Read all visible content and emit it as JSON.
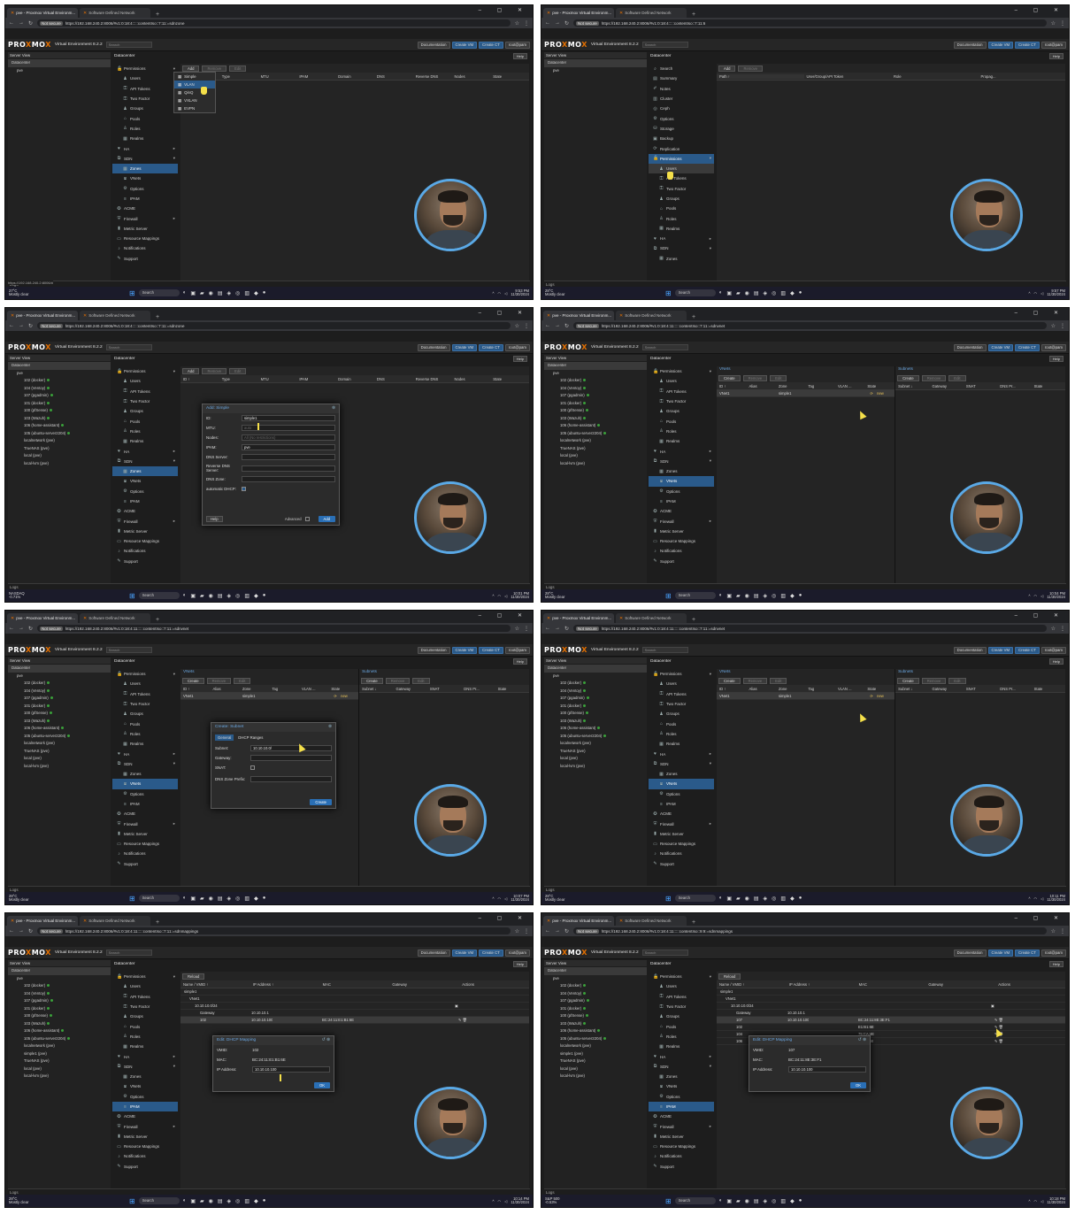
{
  "browser": {
    "tab_pve": "pve - Proxmox Virtual Environm...",
    "tab_sdn": "Software Defined Network",
    "not_secure": "Not secure",
    "urls": [
      "https://192.168.240.2:8006/#v1:0:18:4:::::contentIso::7:11:=sdnzone",
      "https://192.168.240.2:8006/#v1:0:18:4:::::contentIso::7:11:6",
      "https://192.168.240.2:8006/#v1:0:18:4:::::contentIso::7:11:=sdnzone",
      "https://192.168.240.2:8006/#v1:0:18:4:11:::::contentIso::7:11:=sdnvnet",
      "https://192.168.240.2:8006/#v1:0:18:4:11:::::contentIso::7:11:=sdnvnet",
      "https://192.168.240.2:8006/#v1:0:18:4:11:::::contentIso::7:11:=sdnvnet",
      "https://192.168.240.2:8006/#v1:0:18:4:11:::::contentIso::7:11:=sdnmappings",
      "https://192.168.240.2:8006/#v1:0:18:4:11:::::contentIso::9:9:=sdnmappings"
    ]
  },
  "pve": {
    "logo_pre": "PRO",
    "logo_x1": "X",
    "logo_mid": "MO",
    "logo_x2": "X",
    "version": "Virtual Environment 8.2.2",
    "search": "Search",
    "btn_docs": "Documentation",
    "btn_create_vm": "Create VM",
    "btn_create_ct": "Create CT",
    "user": "root@pam",
    "server_view": "Server View",
    "datacenter": "Datacenter",
    "help": "Help",
    "logs": "Logs"
  },
  "tree_short": [
    "Datacenter",
    "pve"
  ],
  "tree_full": [
    "Datacenter",
    "pve",
    "102 (docker)",
    "104 (Ventoy)",
    "107 (pgadmin)",
    "101 (docker)",
    "100 (pfSense)",
    "103 (Wazuh)",
    "106 (home-assistant)",
    "105 (ubuntu-server2204)",
    "localnetwork (pve)",
    "TrueNAS (pve)",
    "local (pve)",
    "local-lvm (pve)"
  ],
  "tree_mapping": [
    "Datacenter",
    "pve",
    "102 (docker)",
    "104 (Ventoy)",
    "107 (pgadmin)",
    "101 (docker)",
    "100 (pfSense)",
    "103 (Wazuh)",
    "106 (home-assistant)",
    "105 (ubuntu-server2204)",
    "localnetwork (pve)",
    "simple1 (pve)",
    "TrueNAS (pve)",
    "local (pve)",
    "local-lvm (pve)"
  ],
  "menu_sdn": [
    {
      "label": "Permissions",
      "icon": "unlock-icon",
      "arrow": "▾"
    },
    {
      "label": "Users",
      "icon": "user-icon",
      "sub": true
    },
    {
      "label": "API Tokens",
      "icon": "key-icon",
      "sub": true
    },
    {
      "label": "Two Factor",
      "icon": "key-icon",
      "sub": true
    },
    {
      "label": "Groups",
      "icon": "users-icon",
      "sub": true
    },
    {
      "label": "Pools",
      "icon": "tags-icon",
      "sub": true
    },
    {
      "label": "Roles",
      "icon": "male-icon",
      "sub": true
    },
    {
      "label": "Realms",
      "icon": "building-icon",
      "sub": true
    },
    {
      "label": "HA",
      "icon": "heartbeat-icon",
      "arrow": "▸"
    },
    {
      "label": "SDN",
      "icon": "sdn-icon",
      "arrow": "▾"
    },
    {
      "label": "Zones",
      "icon": "th-icon",
      "sub": true
    },
    {
      "label": "VNets",
      "icon": "network-icon",
      "sub": true
    },
    {
      "label": "Options",
      "icon": "gear-icon",
      "sub": true
    },
    {
      "label": "IPAM",
      "icon": "list-icon",
      "sub": true
    },
    {
      "label": "ACME",
      "icon": "certificate-icon"
    },
    {
      "label": "Firewall",
      "icon": "shield-icon",
      "arrow": "▸"
    },
    {
      "label": "Metric Server",
      "icon": "bar-chart-icon"
    },
    {
      "label": "Resource Mappings",
      "icon": "folder-icon"
    },
    {
      "label": "Notifications",
      "icon": "bell-icon"
    },
    {
      "label": "Support",
      "icon": "comments-icon"
    }
  ],
  "menu_perm": [
    {
      "label": "Search",
      "icon": "search-icon"
    },
    {
      "label": "Summary",
      "icon": "book-icon"
    },
    {
      "label": "Notes",
      "icon": "note-icon"
    },
    {
      "label": "Cluster",
      "icon": "server-icon"
    },
    {
      "label": "Ceph",
      "icon": "ceph-icon"
    },
    {
      "label": "Options",
      "icon": "gear-icon"
    },
    {
      "label": "Storage",
      "icon": "database-icon"
    },
    {
      "label": "Backup",
      "icon": "floppy-icon"
    },
    {
      "label": "Replication",
      "icon": "retweet-icon"
    },
    {
      "label": "Permissions",
      "icon": "unlock-icon",
      "arrow": "▾",
      "sel": true
    },
    {
      "label": "Users",
      "icon": "user-icon",
      "sub": true,
      "hl": true
    },
    {
      "label": "API Tokens",
      "icon": "key-icon",
      "sub": true
    },
    {
      "label": "Two Factor",
      "icon": "key-icon",
      "sub": true
    },
    {
      "label": "Groups",
      "icon": "users-icon",
      "sub": true
    },
    {
      "label": "Pools",
      "icon": "tags-icon",
      "sub": true
    },
    {
      "label": "Roles",
      "icon": "male-icon",
      "sub": true
    },
    {
      "label": "Realms",
      "icon": "building-icon",
      "sub": true
    },
    {
      "label": "HA",
      "icon": "heartbeat-icon",
      "arrow": "▸"
    },
    {
      "label": "SDN",
      "icon": "sdn-icon",
      "arrow": "▾"
    },
    {
      "label": "Zones",
      "icon": "th-icon",
      "sub": true
    }
  ],
  "zones": {
    "add": "Add",
    "remove": "Remove",
    "edit": "Edit",
    "columns": [
      "ID ↑",
      "Type",
      "MTU",
      "IPAM",
      "Domain",
      "DNS",
      "Reverse DNS",
      "Nodes",
      "State"
    ],
    "dropdown": [
      "Simple",
      "VLAN",
      "QinQ",
      "VXLAN",
      "EVPN"
    ]
  },
  "perm_table": {
    "add": "Add",
    "remove": "Remove",
    "columns": [
      "Path ↑",
      "User/Group/API Token",
      "Role",
      "Propag..."
    ]
  },
  "add_simple": {
    "title": "Add: Simple",
    "fields": [
      {
        "label": "ID:",
        "value": "simple1"
      },
      {
        "label": "MTU:",
        "value": "auto",
        "dis": true
      },
      {
        "label": "Nodes:",
        "value": "All (No restrictions)",
        "dis": true
      },
      {
        "label": "IPAM:",
        "value": "pve"
      },
      {
        "label": "DNS Server:",
        "value": ""
      },
      {
        "label": "Reverse DNS Server:",
        "value": ""
      },
      {
        "label": "DNS Zone:",
        "value": ""
      }
    ],
    "dhcp_label": "automatic DHCP:",
    "help": "Help",
    "advanced": "Advanced",
    "add": "Add"
  },
  "vnets": {
    "title": "VNets",
    "create": "Create",
    "remove": "Remove",
    "edit": "Edit",
    "columns": [
      "ID ↑",
      "Alias",
      "Zone",
      "Tag",
      "VLAN ...",
      "State"
    ],
    "row": {
      "id": "VNet1",
      "alias": "",
      "zone": "simple1",
      "tag": "",
      "vlan": "",
      "state": "new"
    }
  },
  "subnets": {
    "title": "Subnets",
    "create": "Create",
    "remove": "Remove",
    "edit": "Edit",
    "columns": [
      "Subnet ↓",
      "Gateway",
      "SNAT",
      "DNS Pr...",
      "State"
    ]
  },
  "create_subnet": {
    "title": "Create: Subnet",
    "tab_general": "General",
    "tab_dhcp": "DHCP Ranges",
    "fields": [
      {
        "label": "Subnet:",
        "value": "10.10.10.0/"
      },
      {
        "label": "Gateway:",
        "value": ""
      }
    ],
    "snat": "SNAT:",
    "dns_prefix": "DNS Zone Prefix:",
    "create": "Create"
  },
  "mapping": {
    "reload": "Reload",
    "columns": [
      "Name / VMID ↑",
      "IP Address ↑",
      "MAC",
      "Gateway",
      "Actions"
    ],
    "zone": "simple1",
    "vnet": "VNet1",
    "subnet": "10.10.10.0/24",
    "gateway_label": "Gateway",
    "gateway_ip": "10.10.10.1",
    "rows_a": [
      {
        "vmid": "102",
        "ip": "10.10.10.100",
        "mac": "BC:24:11:E1:B1:6E"
      }
    ],
    "rows_b": [
      {
        "vmid": "107",
        "ip": "10.10.10.100",
        "mac": "BC:24:11:8E:3E:F1"
      },
      {
        "vmid": "102",
        "ip": "",
        "mac": "E1:B1:6E"
      },
      {
        "vmid": "104",
        "ip": "",
        "mac": "75:CA:4E"
      },
      {
        "vmid": "106",
        "ip": "",
        "mac": "03:67:B8"
      }
    ]
  },
  "edit_dhcp_a": {
    "title": "Edit: DHCP Mapping",
    "vmid_label": "VMID:",
    "vmid": "102",
    "mac_label": "MAC:",
    "mac": "BC:24:11:E1:B1:6E",
    "ip_label": "IP Address:",
    "ip": "10.10.10.100",
    "ok": "OK"
  },
  "edit_dhcp_b": {
    "title": "Edit: DHCP Mapping",
    "vmid_label": "VMID:",
    "vmid": "107",
    "mac_label": "MAC:",
    "mac": "BC:24:11:8E:3E:F1",
    "ip_label": "IP Address:",
    "ip": "10.10.10.100",
    "ok": "OK"
  },
  "taskbar": {
    "search": "Search",
    "weather": [
      {
        "temp": "27°C",
        "desc": "Mostly clear"
      },
      {
        "temp": "28°C",
        "desc": "Mostly clear"
      },
      {
        "temp": "NASDAQ",
        "desc": "-0.71%"
      },
      {
        "temp": "28°C",
        "desc": "Mostly clear"
      },
      {
        "temp": "28°C",
        "desc": "Mostly clear"
      },
      {
        "temp": "28°C",
        "desc": "Mostly clear"
      },
      {
        "temp": "28°C",
        "desc": "Mostly clear"
      },
      {
        "temp": "S&P 500",
        "desc": "-0.53%"
      }
    ],
    "times": [
      "9:53 PM",
      "9:57 PM",
      "10:01 PM",
      "10:04 PM",
      "10:07 PM",
      "10:11 PM",
      "10:14 PM",
      "10:18 PM"
    ],
    "date": "11/30/2024"
  },
  "status_url": "https://192.168.240.2:8006/#"
}
